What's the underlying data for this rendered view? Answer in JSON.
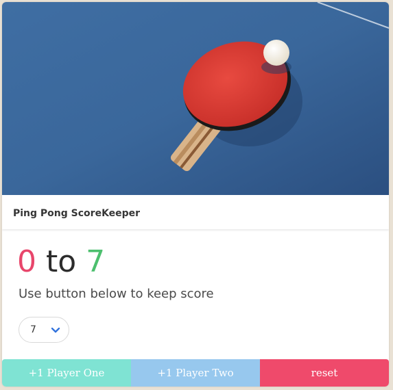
{
  "header": {
    "title": "Ping Pong ScoreKeeper"
  },
  "score": {
    "player_one": "0",
    "separator": "to",
    "player_two": "7"
  },
  "instructions": "Use button below to keep score",
  "winning_score_select": {
    "value": "7"
  },
  "buttons": {
    "player_one": "+1 Player One",
    "player_two": "+1 Player Two",
    "reset": "reset"
  },
  "colors": {
    "player_one_score": "#e8466b",
    "player_two_score": "#4cbf6e",
    "player_one_button": "#7fe3d3",
    "player_two_button": "#97c8ee",
    "reset_button": "#ef4a6b"
  }
}
